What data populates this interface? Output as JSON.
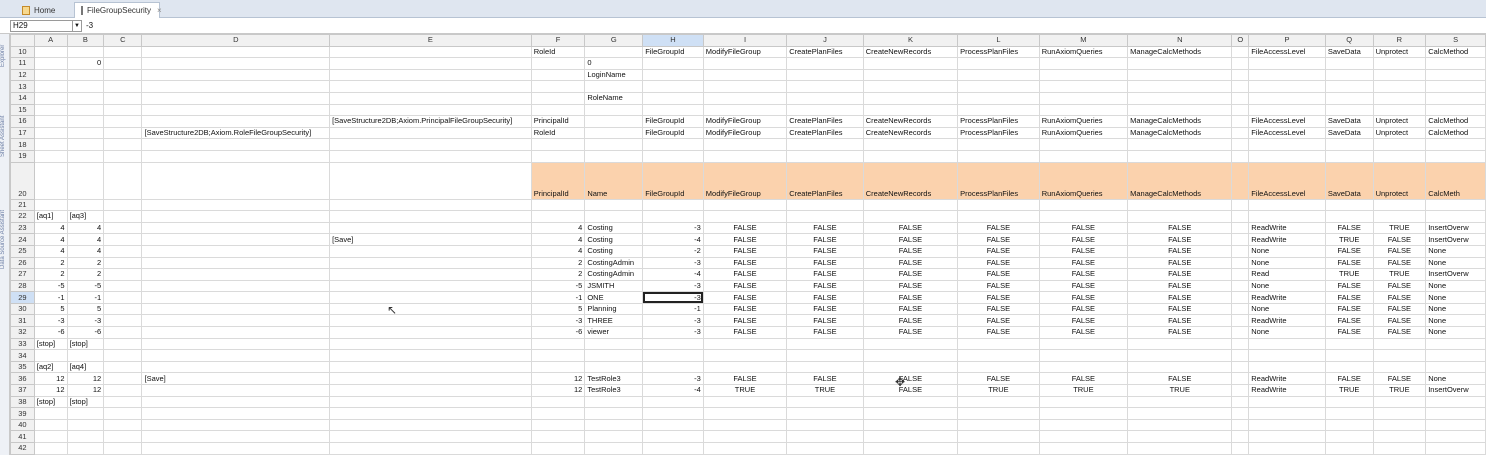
{
  "tabs": [
    {
      "label": "Home",
      "icon": "home-icon"
    },
    {
      "label": "FileGroupSecurity",
      "icon": "spreadsheet-icon",
      "close": "×"
    }
  ],
  "formula_bar": {
    "name_box": "H29",
    "value": "-3"
  },
  "side_labels": [
    "Explorer",
    "Sheet Assistant",
    "Data Source Assistant"
  ],
  "columns": [
    "A",
    "B",
    "C",
    "D",
    "E",
    "F",
    "G",
    "H",
    "I",
    "J",
    "K",
    "L",
    "M",
    "N",
    "O",
    "P",
    "Q",
    "R",
    "S"
  ],
  "selected_column": "H",
  "selected_row": "29",
  "active_cell": {
    "row": "29",
    "col": "H"
  },
  "rows": [
    {
      "n": "10",
      "cells": {
        "F": "RoleId",
        "H": "FileGroupId",
        "I": "ModifyFileGroup",
        "J": "CreatePlanFiles",
        "K": "CreateNewRecords",
        "L": "ProcessPlanFiles",
        "M": "RunAxiomQueries",
        "N": "ManageCalcMethods",
        "P": "FileAccessLevel",
        "Q": "SaveData",
        "R": "Unprotect",
        "S": "CalcMethod"
      }
    },
    {
      "n": "11",
      "cells": {
        "B": "0",
        "G": "0"
      }
    },
    {
      "n": "12",
      "cells": {
        "G": "LoginName"
      }
    },
    {
      "n": "13",
      "cells": {}
    },
    {
      "n": "14",
      "cells": {
        "G": "RoleName"
      }
    },
    {
      "n": "15",
      "cells": {}
    },
    {
      "n": "16",
      "cells": {
        "E": "[SaveStructure2DB;Axiom.PrincipalFileGroupSecurity]",
        "F": "PrincipalId",
        "H": "FileGroupId",
        "I": "ModifyFileGroup",
        "J": "CreatePlanFiles",
        "K": "CreateNewRecords",
        "L": "ProcessPlanFiles",
        "M": "RunAxiomQueries",
        "N": "ManageCalcMethods",
        "P": "FileAccessLevel",
        "Q": "SaveData",
        "R": "Unprotect",
        "S": "CalcMethod"
      }
    },
    {
      "n": "17",
      "cells": {
        "D": "[SaveStructure2DB;Axiom.RoleFileGroupSecurity]",
        "F": "RoleId",
        "H": "FileGroupId",
        "I": "ModifyFileGroup",
        "J": "CreatePlanFiles",
        "K": "CreateNewRecords",
        "L": "ProcessPlanFiles",
        "M": "RunAxiomQueries",
        "N": "ManageCalcMethods",
        "P": "FileAccessLevel",
        "Q": "SaveData",
        "R": "Unprotect",
        "S": "CalcMethod"
      }
    },
    {
      "n": "18",
      "cells": {}
    },
    {
      "n": "19",
      "cells": {}
    },
    {
      "n": "20",
      "tall": true,
      "header": true,
      "cells": {
        "F": "PrincipalId",
        "G": "Name",
        "H": "FileGroupId",
        "I": "ModifyFileGroup",
        "J": "CreatePlanFiles",
        "K": "CreateNewRecords",
        "L": "ProcessPlanFiles",
        "M": "RunAxiomQueries",
        "N": "ManageCalcMethods",
        "O": "",
        "P": "FileAccessLevel",
        "Q": "SaveData",
        "R": "Unprotect",
        "S": "CalcMeth"
      }
    },
    {
      "n": "21",
      "cells": {}
    },
    {
      "n": "22",
      "cells": {
        "A": "[aq1]",
        "B": "[aq3]"
      }
    },
    {
      "n": "23",
      "cells": {
        "A": "4",
        "B": "4",
        "F": "4",
        "G": "Costing",
        "H": "-3",
        "I": "FALSE",
        "J": "FALSE",
        "K": "FALSE",
        "L": "FALSE",
        "M": "FALSE",
        "N": "FALSE",
        "P": "ReadWrite",
        "Q": "FALSE",
        "R": "TRUE",
        "S": "InsertOverw"
      }
    },
    {
      "n": "24",
      "cells": {
        "A": "4",
        "B": "4",
        "E": "[Save]",
        "F": "4",
        "G": "Costing",
        "H": "-4",
        "I": "FALSE",
        "J": "FALSE",
        "K": "FALSE",
        "L": "FALSE",
        "M": "FALSE",
        "N": "FALSE",
        "P": "ReadWrite",
        "Q": "TRUE",
        "R": "FALSE",
        "S": "InsertOverw"
      }
    },
    {
      "n": "25",
      "cells": {
        "A": "4",
        "B": "4",
        "F": "4",
        "G": "Costing",
        "H": "-2",
        "I": "FALSE",
        "J": "FALSE",
        "K": "FALSE",
        "L": "FALSE",
        "M": "FALSE",
        "N": "FALSE",
        "P": "None",
        "Q": "FALSE",
        "R": "FALSE",
        "S": "None"
      }
    },
    {
      "n": "26",
      "cells": {
        "A": "2",
        "B": "2",
        "F": "2",
        "G": "CostingAdmin",
        "H": "-3",
        "I": "FALSE",
        "J": "FALSE",
        "K": "FALSE",
        "L": "FALSE",
        "M": "FALSE",
        "N": "FALSE",
        "P": "None",
        "Q": "FALSE",
        "R": "FALSE",
        "S": "None"
      }
    },
    {
      "n": "27",
      "cells": {
        "A": "2",
        "B": "2",
        "F": "2",
        "G": "CostingAdmin",
        "H": "-4",
        "I": "FALSE",
        "J": "FALSE",
        "K": "FALSE",
        "L": "FALSE",
        "M": "FALSE",
        "N": "FALSE",
        "P": "Read",
        "Q": "TRUE",
        "R": "TRUE",
        "S": "InsertOverw"
      }
    },
    {
      "n": "28",
      "cells": {
        "A": "-5",
        "B": "-5",
        "F": "-5",
        "G": "JSMITH",
        "H": "-3",
        "I": "FALSE",
        "J": "FALSE",
        "K": "FALSE",
        "L": "FALSE",
        "M": "FALSE",
        "N": "FALSE",
        "P": "None",
        "Q": "FALSE",
        "R": "FALSE",
        "S": "None"
      }
    },
    {
      "n": "29",
      "cells": {
        "A": "-1",
        "B": "-1",
        "F": "-1",
        "G": "ONE",
        "H": "-3",
        "I": "FALSE",
        "J": "FALSE",
        "K": "FALSE",
        "L": "FALSE",
        "M": "FALSE",
        "N": "FALSE",
        "P": "ReadWrite",
        "Q": "FALSE",
        "R": "FALSE",
        "S": "None"
      }
    },
    {
      "n": "30",
      "cells": {
        "A": "5",
        "B": "5",
        "F": "5",
        "G": "Planning",
        "H": "-1",
        "I": "FALSE",
        "J": "FALSE",
        "K": "FALSE",
        "L": "FALSE",
        "M": "FALSE",
        "N": "FALSE",
        "P": "None",
        "Q": "FALSE",
        "R": "FALSE",
        "S": "None"
      }
    },
    {
      "n": "31",
      "cells": {
        "A": "-3",
        "B": "-3",
        "F": "-3",
        "G": "THREE",
        "H": "-3",
        "I": "FALSE",
        "J": "FALSE",
        "K": "FALSE",
        "L": "FALSE",
        "M": "FALSE",
        "N": "FALSE",
        "P": "ReadWrite",
        "Q": "FALSE",
        "R": "FALSE",
        "S": "None"
      }
    },
    {
      "n": "32",
      "cells": {
        "A": "-6",
        "B": "-6",
        "F": "-6",
        "G": "viewer",
        "H": "-3",
        "I": "FALSE",
        "J": "FALSE",
        "K": "FALSE",
        "L": "FALSE",
        "M": "FALSE",
        "N": "FALSE",
        "P": "None",
        "Q": "FALSE",
        "R": "FALSE",
        "S": "None"
      }
    },
    {
      "n": "33",
      "cells": {
        "A": "[stop]",
        "B": "[stop]"
      }
    },
    {
      "n": "34",
      "cells": {}
    },
    {
      "n": "35",
      "cells": {
        "A": "[aq2]",
        "B": "[aq4]"
      }
    },
    {
      "n": "36",
      "cells": {
        "A": "12",
        "B": "12",
        "D": "[Save]",
        "F": "12",
        "G": "TestRole3",
        "H": "-3",
        "I": "FALSE",
        "J": "FALSE",
        "K": "FALSE",
        "L": "FALSE",
        "M": "FALSE",
        "N": "FALSE",
        "P": "ReadWrite",
        "Q": "FALSE",
        "R": "FALSE",
        "S": "None"
      }
    },
    {
      "n": "37",
      "cells": {
        "A": "12",
        "B": "12",
        "F": "12",
        "G": "TestRole3",
        "H": "-4",
        "I": "TRUE",
        "J": "TRUE",
        "K": "FALSE",
        "L": "TRUE",
        "M": "TRUE",
        "N": "TRUE",
        "P": "ReadWrite",
        "Q": "TRUE",
        "R": "TRUE",
        "S": "InsertOverw"
      }
    },
    {
      "n": "38",
      "cells": {
        "A": "[stop]",
        "B": "[stop]"
      }
    },
    {
      "n": "39",
      "cells": {}
    },
    {
      "n": "40",
      "cells": {}
    },
    {
      "n": "41",
      "cells": {}
    },
    {
      "n": "42",
      "cells": {}
    }
  ]
}
